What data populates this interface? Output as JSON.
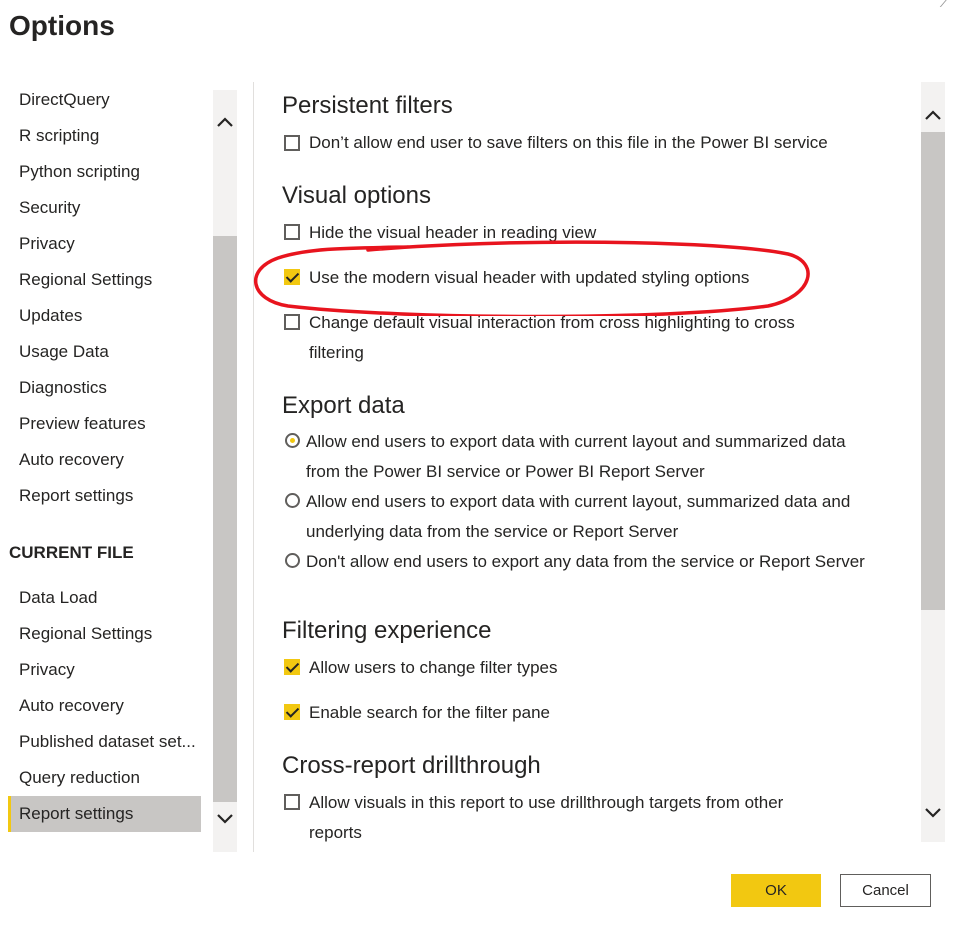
{
  "window": {
    "title": "Options"
  },
  "nav": {
    "global_items": [
      {
        "label": "DirectQuery"
      },
      {
        "label": "R scripting"
      },
      {
        "label": "Python scripting"
      },
      {
        "label": "Security"
      },
      {
        "label": "Privacy"
      },
      {
        "label": "Regional Settings"
      },
      {
        "label": "Updates"
      },
      {
        "label": "Usage Data"
      },
      {
        "label": "Diagnostics"
      },
      {
        "label": "Preview features"
      },
      {
        "label": "Auto recovery"
      },
      {
        "label": "Report settings"
      }
    ],
    "current_file_header": "CURRENT FILE",
    "current_file_items": [
      {
        "label": "Data Load"
      },
      {
        "label": "Regional Settings"
      },
      {
        "label": "Privacy"
      },
      {
        "label": "Auto recovery"
      },
      {
        "label": "Published dataset set..."
      },
      {
        "label": "Query reduction"
      },
      {
        "label": "Report settings",
        "selected": true
      }
    ]
  },
  "main": {
    "persistent_filters": {
      "heading": "Persistent filters",
      "options": [
        {
          "label": "Don’t allow end user to save filters on this file in the Power BI service",
          "checked": false
        }
      ]
    },
    "visual_options": {
      "heading": "Visual options",
      "options": [
        {
          "label": "Hide the visual header in reading view",
          "checked": false
        },
        {
          "label": "Use the modern visual header with updated styling options",
          "checked": true
        },
        {
          "label": "Change default visual interaction from cross highlighting to cross filtering",
          "checked": false
        }
      ]
    },
    "export_data": {
      "heading": "Export data",
      "options": [
        {
          "label": "Allow end users to export data with current layout and summarized data from the Power BI service or Power BI Report Server",
          "selected": true
        },
        {
          "label": "Allow end users to export data with current layout, summarized data and underlying data from the service or Report Server",
          "selected": false
        },
        {
          "label": "Don't allow end users to export any data from the service or Report Server",
          "selected": false
        }
      ]
    },
    "filtering_experience": {
      "heading": "Filtering experience",
      "options": [
        {
          "label": "Allow users to change filter types",
          "checked": true
        },
        {
          "label": "Enable search for the filter pane",
          "checked": true
        }
      ]
    },
    "cross_report": {
      "heading": "Cross-report drillthrough",
      "options": [
        {
          "label": "Allow visuals in this report to use drillthrough targets from other reports",
          "checked": false
        }
      ]
    }
  },
  "buttons": {
    "ok": "OK",
    "cancel": "Cancel"
  },
  "colors": {
    "accent": "#f2c811",
    "annotation": "#e8141e",
    "selected_bg": "#c8c6c4"
  }
}
